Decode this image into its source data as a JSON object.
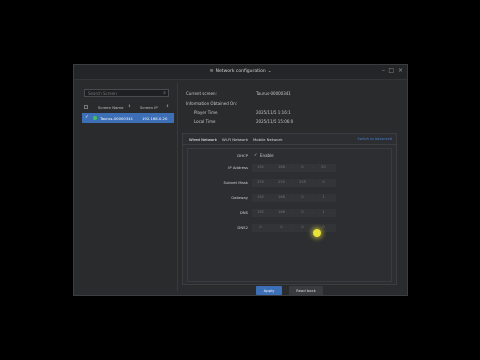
{
  "window": {
    "title": "Network configuration"
  },
  "sidebar": {
    "search_placeholder": "Search Screen",
    "columns": {
      "name": "Screen Name",
      "ip": "Screen IP"
    },
    "rows": [
      {
        "name": "Taurus-00000341",
        "ip": "192.168.0.20",
        "status": "online"
      }
    ]
  },
  "info": {
    "current_screen_label": "Current screen:",
    "current_screen_value": "Taurus-00000341",
    "obtained_on_label": "Information Obtained On:",
    "player_time_label": "Player Time",
    "player_time_value": "2025/11/5 1:16:1",
    "local_time_label": "Local Time",
    "local_time_value": "2025/11/5 15:06:0"
  },
  "tabs": [
    "Wired Network",
    "Wi-Fi Network",
    "Mobile Network"
  ],
  "active_tab": 0,
  "advanced_link": "Switch to Advanced",
  "form": {
    "dhcp_label": "DHCP",
    "dhcp_enable": "Enable",
    "fields": [
      {
        "label": "IP Address",
        "octets": [
          "192",
          "168",
          "0",
          "20"
        ]
      },
      {
        "label": "Subnet Mask",
        "octets": [
          "255",
          "255",
          "255",
          "0"
        ]
      },
      {
        "label": "Gateway",
        "octets": [
          "192",
          "168",
          "0",
          "1"
        ]
      },
      {
        "label": "DNS",
        "octets": [
          "192",
          "168",
          "0",
          "1"
        ]
      },
      {
        "label": "DNS2",
        "octets": [
          "0",
          "0",
          "0",
          "0"
        ]
      }
    ]
  },
  "buttons": {
    "apply": "Apply",
    "read_back": "Read back"
  },
  "colors": {
    "accent": "#3d6fb6",
    "online": "#3fbf5c",
    "cursor_highlight": "#e8e23a"
  }
}
